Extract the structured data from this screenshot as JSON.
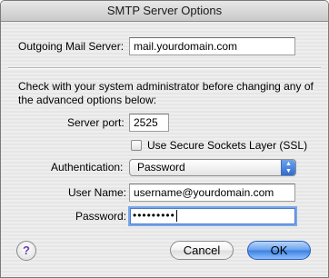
{
  "window": {
    "title": "SMTP Server Options"
  },
  "outgoing": {
    "label": "Outgoing Mail Server:",
    "value": "mail.yourdomain.com"
  },
  "note": "Check with your system administrator before changing any of the advanced options below:",
  "port": {
    "label": "Server port:",
    "value": "2525"
  },
  "ssl": {
    "label": "Use Secure Sockets Layer (SSL)",
    "checked": false
  },
  "auth": {
    "label": "Authentication:",
    "selected": "Password"
  },
  "username": {
    "label": "User Name:",
    "value": "username@yourdomain.com"
  },
  "password": {
    "label": "Password:",
    "masked": "•••••••••"
  },
  "buttons": {
    "help": "?",
    "cancel": "Cancel",
    "ok": "OK"
  }
}
